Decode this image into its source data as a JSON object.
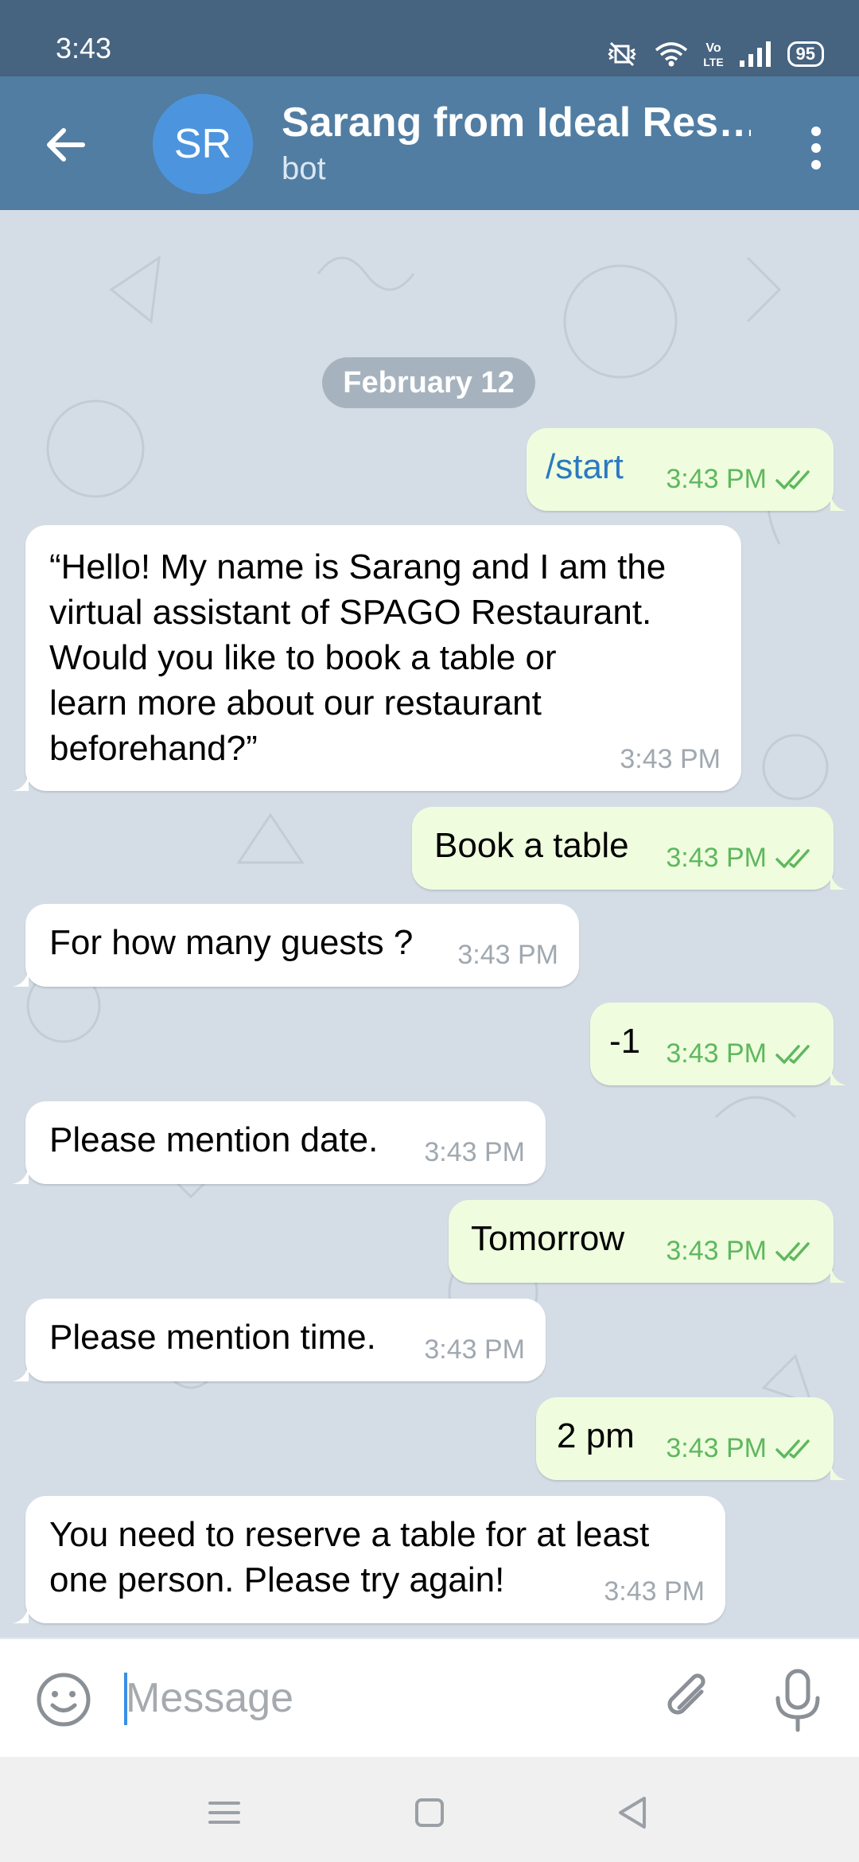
{
  "status_bar": {
    "time": "3:43",
    "battery": "95"
  },
  "header": {
    "avatar_initials": "SR",
    "title": "Sarang from Ideal Res…",
    "subtitle": "bot"
  },
  "chat": {
    "date_separator": "February 12",
    "messages": [
      {
        "direction": "out",
        "text": "/start",
        "time": "3:43 PM",
        "read": true
      },
      {
        "direction": "in",
        "lines": [
          "“Hello! My name is Sarang and I am the",
          "virtual assistant of SPAGO Restaurant.",
          "Would you like to book a table or",
          "learn more about our restaurant",
          "beforehand?”"
        ],
        "time": "3:43 PM"
      },
      {
        "direction": "out",
        "text": "Book a table",
        "time": "3:43 PM",
        "read": true
      },
      {
        "direction": "in",
        "text": "For how many guests ?",
        "time": "3:43 PM"
      },
      {
        "direction": "out",
        "text": "-1",
        "time": "3:43 PM",
        "read": true
      },
      {
        "direction": "in",
        "text": "Please mention date.",
        "time": "3:43 PM"
      },
      {
        "direction": "out",
        "text": "Tomorrow",
        "time": "3:43 PM",
        "read": true
      },
      {
        "direction": "in",
        "text": "Please mention time.",
        "time": "3:43 PM"
      },
      {
        "direction": "out",
        "text": "2 pm",
        "time": "3:43 PM",
        "read": true
      },
      {
        "direction": "in",
        "lines": [
          "You need to reserve a table for at least",
          "one person. Please try again!"
        ],
        "time": "3:43 PM"
      }
    ]
  },
  "composer": {
    "placeholder": "Message"
  },
  "icons": {
    "back": "arrow-left-icon",
    "menu": "more-vertical-icon",
    "emoji": "emoji-icon",
    "attach": "paperclip-icon",
    "mic": "microphone-icon",
    "read_receipt": "double-check-icon"
  },
  "colors": {
    "header": "#517da2",
    "status_bar": "#46637f",
    "avatar": "#4c95de",
    "incoming_bubble": "#ffffff",
    "outgoing_bubble": "#effdde",
    "read_check": "#5fb75f",
    "command_link": "#2b79c2"
  }
}
